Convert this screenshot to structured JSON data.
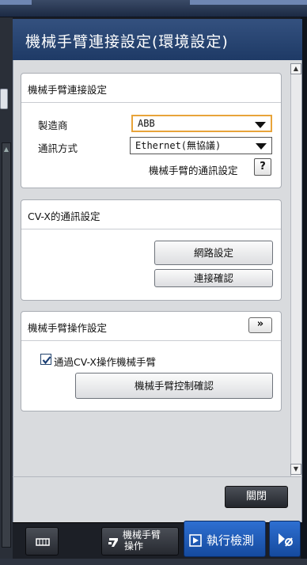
{
  "dialog": {
    "title": "機械手臂連接設定(環境設定)"
  },
  "robot_connection": {
    "title": "機械手臂連接設定",
    "manufacturer_label": "製造商",
    "manufacturer_value": "ABB",
    "comm_method_label": "通訊方式",
    "comm_method_value": "Ethernet(無協議)",
    "robot_comm_settings_label": "機械手臂的通訊設定",
    "help_label": "?"
  },
  "cvx_comm": {
    "title": "CV-X的通訊設定",
    "network_settings_label": "網路設定",
    "connection_check_label": "連接確認"
  },
  "robot_operation": {
    "title": "機械手臂操作設定",
    "expand_label": "»",
    "checkbox_label": "通過CV-X操作機械手臂",
    "checkbox_checked": true,
    "control_check_label": "機械手臂控制確認"
  },
  "footer": {
    "close_label": "關閉"
  },
  "toolbar": {
    "robot_operation_line1": "機械手臂",
    "robot_operation_line2": "操作",
    "run_detection_label": "執行檢測"
  },
  "colors": {
    "header_blue": "#1e3a66",
    "focus_orange": "#e8a43a",
    "run_blue": "#2e6fd1"
  }
}
